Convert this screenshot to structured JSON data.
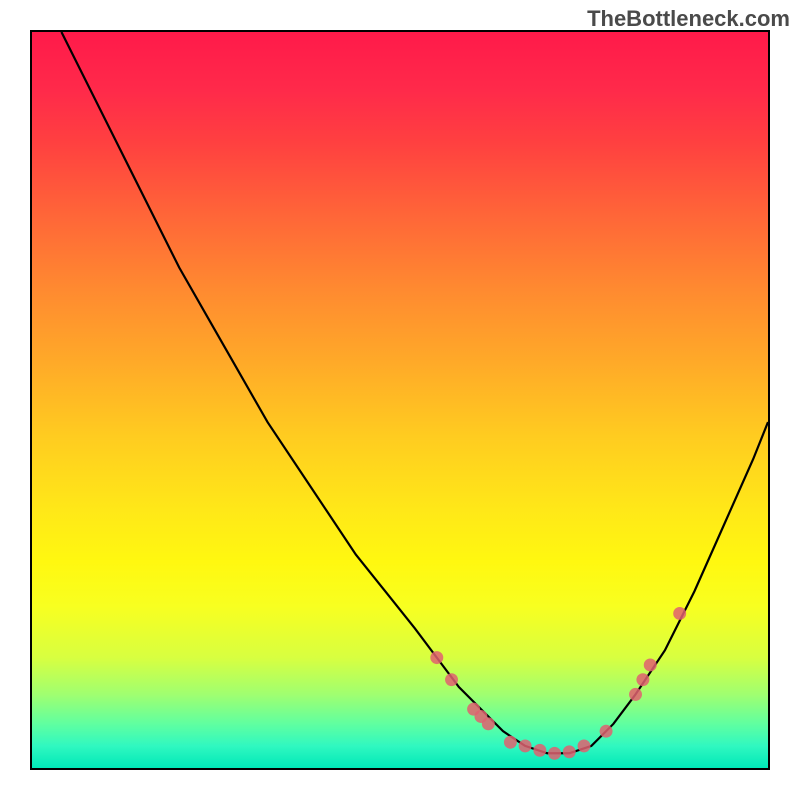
{
  "watermark": "TheBottleneck.com",
  "chart_data": {
    "type": "line",
    "title": "",
    "xlabel": "",
    "ylabel": "",
    "xlim": [
      0,
      100
    ],
    "ylim": [
      0,
      100
    ],
    "grid": false,
    "series": [
      {
        "name": "bottleneck-curve",
        "x": [
          4,
          8,
          12,
          16,
          20,
          24,
          28,
          32,
          36,
          40,
          44,
          48,
          52,
          55,
          58,
          61,
          64,
          67,
          70,
          73,
          76,
          79,
          82,
          86,
          90,
          94,
          98,
          100
        ],
        "y": [
          100,
          92,
          84,
          76,
          68,
          61,
          54,
          47,
          41,
          35,
          29,
          24,
          19,
          15,
          11,
          8,
          5,
          3,
          2,
          2,
          3,
          6,
          10,
          16,
          24,
          33,
          42,
          47
        ]
      }
    ],
    "markers": {
      "name": "highlight-dots",
      "color": "#e06070",
      "points": [
        {
          "x": 55,
          "y": 15
        },
        {
          "x": 57,
          "y": 12
        },
        {
          "x": 60,
          "y": 8
        },
        {
          "x": 61,
          "y": 7
        },
        {
          "x": 62,
          "y": 6
        },
        {
          "x": 65,
          "y": 3.5
        },
        {
          "x": 67,
          "y": 3
        },
        {
          "x": 69,
          "y": 2.4
        },
        {
          "x": 71,
          "y": 2
        },
        {
          "x": 73,
          "y": 2.2
        },
        {
          "x": 75,
          "y": 3
        },
        {
          "x": 78,
          "y": 5
        },
        {
          "x": 82,
          "y": 10
        },
        {
          "x": 83,
          "y": 12
        },
        {
          "x": 84,
          "y": 14
        },
        {
          "x": 88,
          "y": 21
        }
      ]
    },
    "gradient_stops": [
      {
        "pos": 0,
        "color": "#ff1a4a"
      },
      {
        "pos": 50,
        "color": "#ffcc20"
      },
      {
        "pos": 100,
        "color": "#00e8b8"
      }
    ]
  }
}
